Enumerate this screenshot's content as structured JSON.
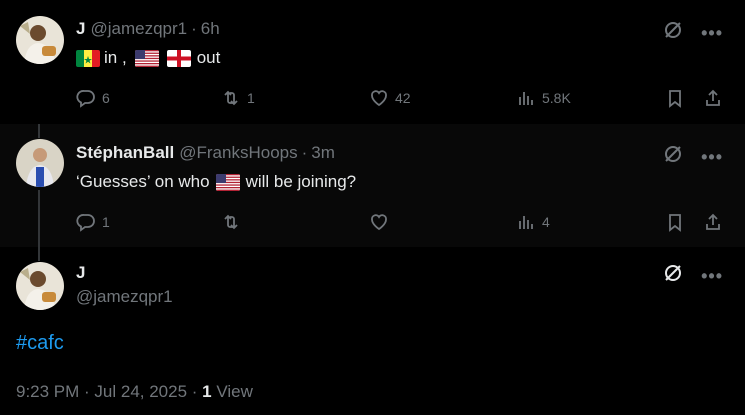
{
  "tweets": [
    {
      "name": "J",
      "handle": "@jamezqpr1",
      "time": "6h",
      "text_parts": [
        "in ,",
        "out"
      ],
      "flags": [
        "senegal",
        "usa",
        "england"
      ],
      "replies": "6",
      "retweets": "1",
      "likes": "42",
      "views": "5.8K"
    },
    {
      "name": "StéphanBall",
      "handle": "@FranksHoops",
      "time": "3m",
      "text_before": "‘Guesses’ on who",
      "text_after": "will be joining?",
      "flags": [
        "usa"
      ],
      "replies": "1",
      "retweets": "",
      "likes": "",
      "views": "4"
    }
  ],
  "main_tweet": {
    "name": "J",
    "handle": "@jamezqpr1",
    "hashtag": "#cafc",
    "timestamp": "9:23 PM · Jul 24, 2025 ·",
    "view_count": "1",
    "view_label": "View"
  },
  "separator": "·",
  "icons": {
    "reply": "reply-icon",
    "retweet": "retweet-icon",
    "like": "heart-icon",
    "views": "views-icon",
    "bookmark": "bookmark-icon",
    "share": "share-icon",
    "grok": "grok-icon",
    "more": "more-icon"
  },
  "colors": {
    "background": "#000000",
    "highlighted_background": "#080808",
    "text": "#e7e9ea",
    "secondary": "#71767b",
    "link": "#1d9bf0"
  }
}
